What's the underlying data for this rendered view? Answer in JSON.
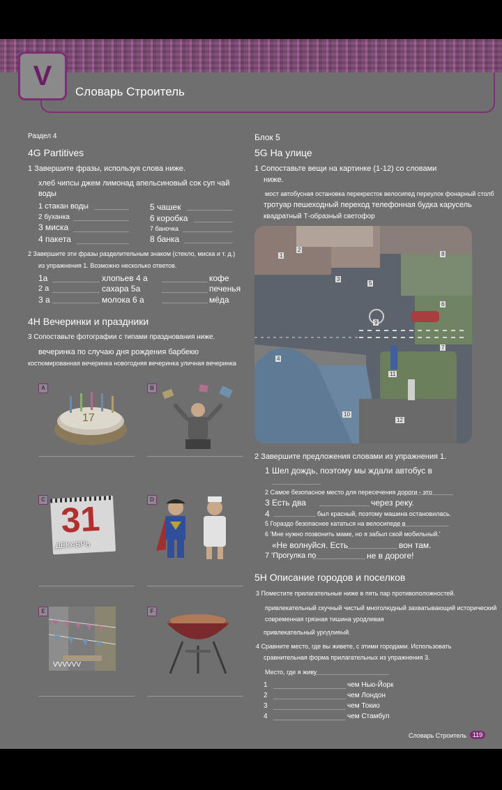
{
  "header": {
    "letter": "V",
    "title": "Словарь Строитель"
  },
  "left": {
    "unit": "Раздел 4",
    "sec4g": "4G Partitives",
    "ex1": "1 Завершите фразы, используя слова ниже.",
    "words1": "хлеб чипсы джем лимонад апельсиновый сок суп чай",
    "words1b": "воды",
    "items1": [
      "1 стакан воды",
      "2 буханка",
      "3 миска",
      "4 пакета",
      "5 чашек",
      "6 коробка",
      "7 баночка",
      "8 банка"
    ],
    "ex2a": "2 Завершите эти фразы разделительным знаком (стекло, миска и т. д.)",
    "ex2b": "из упражнения 1. Возможно несколько ответов.",
    "items2": [
      "1а",
      "хлопьев 4 а",
      "кофе",
      "2 а",
      "сахара 5а",
      "печенья",
      "3 а",
      "молока 6 а",
      "мёда"
    ],
    "sec4h": "4H Вечеринки и праздники",
    "ex3": "3 Сопоставьте фотографии с типами празднования ниже.",
    "words3a": "вечеринка по случаю дня рождения барбекю",
    "words3b": "костюмированная вечеринка новогодняя вечеринка уличная вечеринка",
    "pic_labels": [
      "A",
      "B",
      "C",
      "D",
      "E",
      "F"
    ],
    "calendar_day": "31",
    "calendar_month": "ДЕКАБРЬ",
    "flags_text": "VVVVVV"
  },
  "right": {
    "unit": "Блок 5",
    "sec5g": "5G На улице",
    "ex1a": "1 Сопоставьте вещи на картинке (1-12) со словами",
    "ex1b": "ниже.",
    "words1a": "мост автобусная остановка перекресток велосипед переулок фонарный столб",
    "words1b": "тротуар пешеходный переход телефонная будка карусель",
    "words1c": "квадратный Т-образный светофор",
    "map_numbers": [
      "1",
      "2",
      "3",
      "4",
      "5",
      "6",
      "7",
      "8",
      "9",
      "10",
      "11",
      "12"
    ],
    "ex2": "2 Завершите предложения словами из упражнения 1.",
    "sentences": [
      "1 Шел дождь, поэтому мы ждали автобус в",
      "2 Самое безопасное место для пересечения дороги - это",
      "3 Есть два",
      "через реку.",
      "4",
      "был красный, поэтому машина остановилась.",
      "5 Гораздо безопаснее кататься на велосипеде в",
      "6 'Мне нужно позвонить маме, но я забыл свой мобильный.'",
      "«Не волнуйся.  Есть",
      "вон там.",
      "7 'Прогулка по",
      "не в дороге!"
    ],
    "sec5h": "5H Описание городов и поселков",
    "ex3": "3 Поместите прилагательные ниже в пять пар противоположностей.",
    "adj1": "привлекательный скучный чистый многолюдный захватывающий исторический",
    "adj2": "современная грязная тишина уродливая",
    "adj3": "привлекательный уродливый",
    "ex4a": "4 Сравните место, где вы живете, с этими городами.  Использовать",
    "ex4b": "сравнительная форма прилагательных из упражнения 3.",
    "place": "Место, где я живу",
    "compare": [
      {
        "n": "1",
        "city": "чем Нью-Йорк"
      },
      {
        "n": "2",
        "city": "чем Лондон"
      },
      {
        "n": "3",
        "city": "чем Токио"
      },
      {
        "n": "4",
        "city": "чем Стамбул"
      }
    ],
    "footer": "Словарь Строитель",
    "page_no": "119"
  }
}
